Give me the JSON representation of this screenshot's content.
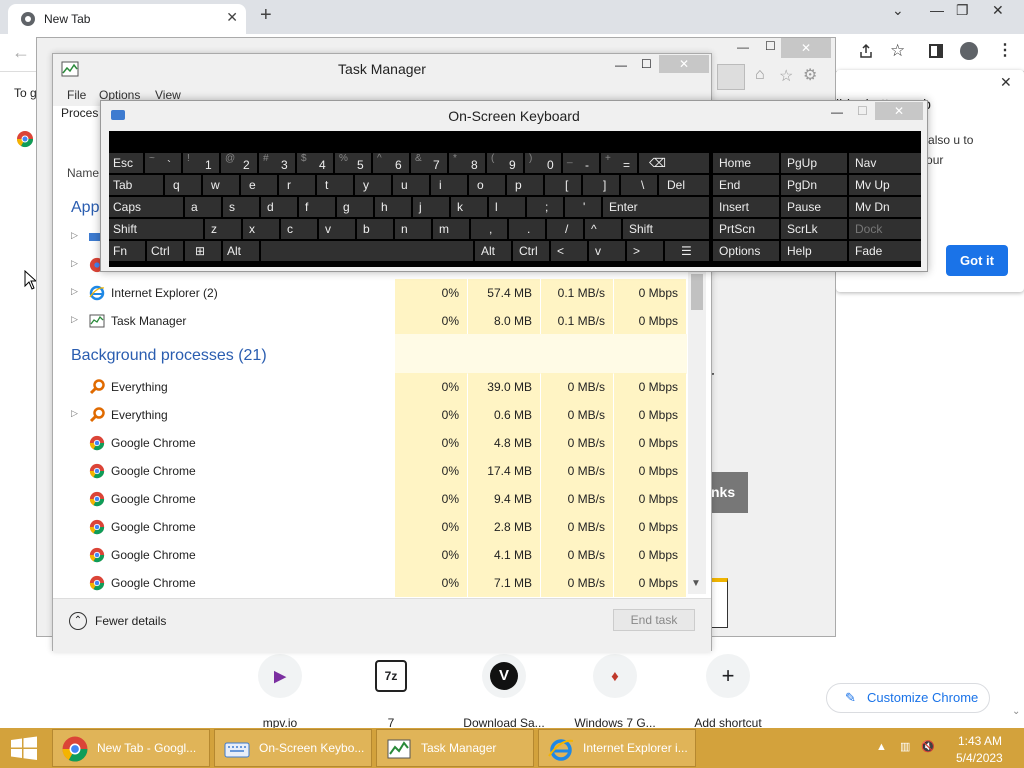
{
  "chrome": {
    "tab_title": "New Tab",
    "side_text": "To g",
    "promo": {
      "title": "ild a better web",
      "text": "racking and ome also u to manage me for your",
      "got_it": "Got it"
    },
    "bg_r": "r",
    "bg_nks": "nks",
    "shortcuts": [
      {
        "label": "mpv.io",
        "glyph": "▶"
      },
      {
        "label": "7",
        "glyph": "7z"
      },
      {
        "label": "Download Sa...",
        "glyph": "V"
      },
      {
        "label": "Windows 7 G...",
        "glyph": "♦"
      },
      {
        "label": "Add shortcut",
        "glyph": "+"
      }
    ],
    "customize": "Customize Chrome"
  },
  "task_manager": {
    "title": "Task Manager",
    "menu": [
      "File",
      "Options",
      "View"
    ],
    "tab": "Proces",
    "col_name": "Name",
    "apps_header": "App",
    "bg_header": "Background processes (21)",
    "apps": [
      {
        "name": "Internet Explorer (2)",
        "cpu": "0%",
        "mem": "57.4 MB",
        "disk": "0.1 MB/s",
        "net": "0 Mbps"
      },
      {
        "name": "Task Manager",
        "cpu": "0%",
        "mem": "8.0 MB",
        "disk": "0.1 MB/s",
        "net": "0 Mbps"
      }
    ],
    "background": [
      {
        "name": "Everything",
        "cpu": "0%",
        "mem": "39.0 MB",
        "disk": "0 MB/s",
        "net": "0 Mbps"
      },
      {
        "name": "Everything",
        "cpu": "0%",
        "mem": "0.6 MB",
        "disk": "0 MB/s",
        "net": "0 Mbps"
      },
      {
        "name": "Google Chrome",
        "cpu": "0%",
        "mem": "4.8 MB",
        "disk": "0 MB/s",
        "net": "0 Mbps"
      },
      {
        "name": "Google Chrome",
        "cpu": "0%",
        "mem": "17.4 MB",
        "disk": "0 MB/s",
        "net": "0 Mbps"
      },
      {
        "name": "Google Chrome",
        "cpu": "0%",
        "mem": "9.4 MB",
        "disk": "0 MB/s",
        "net": "0 Mbps"
      },
      {
        "name": "Google Chrome",
        "cpu": "0%",
        "mem": "2.8 MB",
        "disk": "0 MB/s",
        "net": "0 Mbps"
      },
      {
        "name": "Google Chrome",
        "cpu": "0%",
        "mem": "4.1 MB",
        "disk": "0 MB/s",
        "net": "0 Mbps"
      },
      {
        "name": "Google Chrome",
        "cpu": "0%",
        "mem": "7.1 MB",
        "disk": "0 MB/s",
        "net": "0 Mbps"
      }
    ],
    "fewer_details": "Fewer details",
    "end_task": "End task"
  },
  "osk": {
    "title": "On-Screen Keyboard",
    "row1": [
      {
        "m": "Esc"
      },
      {
        "s": "~",
        "m": "`"
      },
      {
        "s": "!",
        "m": "1"
      },
      {
        "s": "@",
        "m": "2"
      },
      {
        "s": "#",
        "m": "3"
      },
      {
        "s": "$",
        "m": "4"
      },
      {
        "s": "%",
        "m": "5"
      },
      {
        "s": "^",
        "m": "6"
      },
      {
        "s": "&",
        "m": "7"
      },
      {
        "s": "*",
        "m": "8"
      },
      {
        "s": "(",
        "m": "9"
      },
      {
        "s": ")",
        "m": "0"
      },
      {
        "s": "_",
        "m": "-"
      },
      {
        "s": "+",
        "m": "="
      },
      {
        "m": "⌫"
      }
    ],
    "row2": [
      "Tab",
      "q",
      "w",
      "e",
      "r",
      "t",
      "y",
      "u",
      "i",
      "o",
      "p",
      "[",
      "]",
      "\\",
      "Del"
    ],
    "row3": [
      "Caps",
      "a",
      "s",
      "d",
      "f",
      "g",
      "h",
      "j",
      "k",
      "l",
      ";",
      "'",
      "Enter"
    ],
    "row4": [
      "Shift",
      "z",
      "x",
      "c",
      "v",
      "b",
      "n",
      "m",
      ",",
      ".",
      "/",
      "^",
      "Shift"
    ],
    "row5": [
      "Fn",
      "Ctrl",
      "⊞",
      "Alt",
      "",
      "Alt",
      "Ctrl",
      "<",
      "v",
      ">",
      "☰"
    ],
    "nav": [
      [
        "Home",
        "PgUp",
        "Nav"
      ],
      [
        "End",
        "PgDn",
        "Mv Up"
      ],
      [
        "Insert",
        "Pause",
        "Mv Dn"
      ],
      [
        "PrtScn",
        "ScrLk",
        "Dock"
      ],
      [
        "Options",
        "Help",
        "Fade"
      ]
    ]
  },
  "taskbar": {
    "items": [
      {
        "label": "New Tab - Googl..."
      },
      {
        "label": "On-Screen Keybo..."
      },
      {
        "label": "Task Manager"
      },
      {
        "label": "Internet Explorer i..."
      }
    ],
    "time": "1:43 AM",
    "date": "5/4/2023"
  }
}
